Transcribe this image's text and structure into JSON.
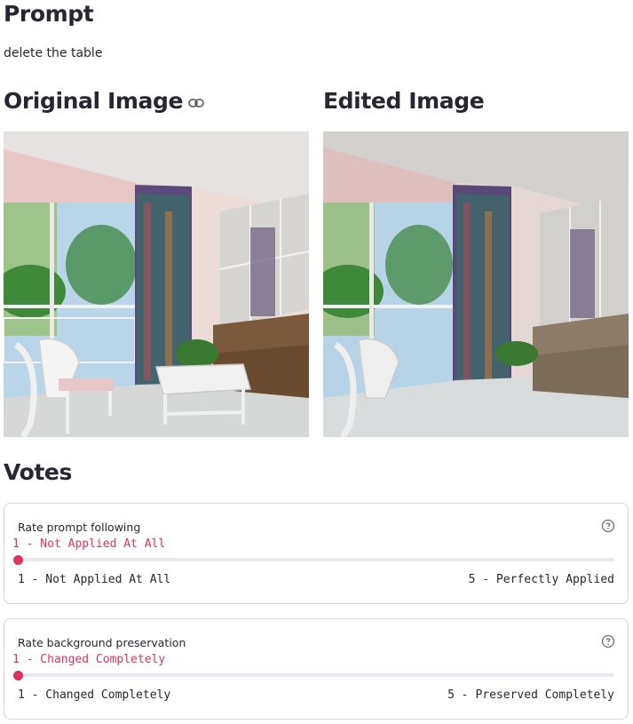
{
  "prompt": {
    "heading": "Prompt",
    "text": "delete the table"
  },
  "original": {
    "heading": "Original Image"
  },
  "edited": {
    "heading": "Edited Image"
  },
  "votes": {
    "heading": "Votes",
    "sliders": [
      {
        "label": "Rate prompt following",
        "value_text": "1 - Not Applied At All",
        "min_label": "1 - Not Applied At All",
        "max_label": "5 - Perfectly Applied",
        "value": 1,
        "min": 1,
        "max": 5
      },
      {
        "label": "Rate background preservation",
        "value_text": "1 - Changed Completely",
        "min_label": "1 - Changed Completely",
        "max_label": "5 - Preserved Completely",
        "value": 1,
        "min": 1,
        "max": 5
      }
    ]
  },
  "colors": {
    "accent": "#e0325f",
    "text": "#262730",
    "border": "#d5d6da"
  }
}
